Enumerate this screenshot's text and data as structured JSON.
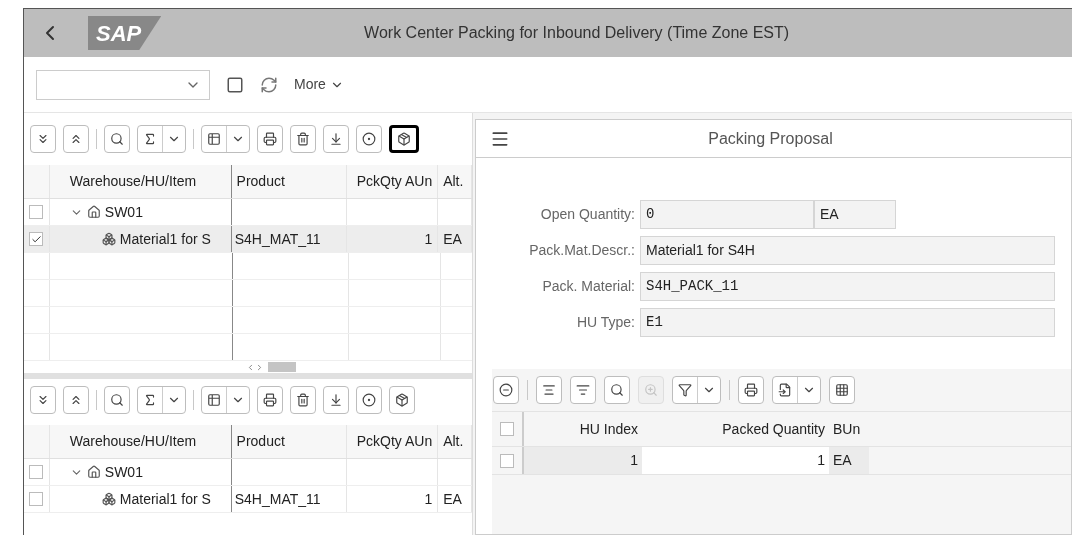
{
  "header": {
    "logo": "SAP",
    "title": "Work Center Packing for Inbound Delivery (Time Zone EST)"
  },
  "toolbar": {
    "more": "More"
  },
  "left_panel": {
    "upper_toolbar": [
      {
        "kind": "expand-all",
        "highlighted": false
      },
      {
        "kind": "collapse-all",
        "highlighted": false
      },
      {
        "kind": "sep"
      },
      {
        "kind": "search",
        "highlighted": false
      },
      {
        "kind": "sum",
        "highlighted": false
      },
      {
        "kind": "sep"
      },
      {
        "kind": "layout",
        "highlighted": false
      },
      {
        "kind": "print",
        "highlighted": false
      },
      {
        "kind": "delete",
        "highlighted": false
      },
      {
        "kind": "unpack",
        "highlighted": false
      },
      {
        "kind": "pie",
        "highlighted": false
      },
      {
        "kind": "pack",
        "highlighted": true
      }
    ],
    "upper_table": {
      "columns": [
        "Warehouse/HU/Item",
        "Product",
        "PckQty AUn",
        "Alt."
      ],
      "rows": [
        {
          "kind": "warehouse",
          "checked": false,
          "selected": false,
          "expanded": true,
          "item": "SW01"
        },
        {
          "kind": "product",
          "checked": true,
          "selected": true,
          "item": "Material1 for S",
          "product": "S4H_MAT_11",
          "qty": "1",
          "unit": "EA"
        }
      ]
    },
    "lower_toolbar": [
      {
        "kind": "expand-all",
        "highlighted": false
      },
      {
        "kind": "collapse-all",
        "highlighted": false
      },
      {
        "kind": "sep"
      },
      {
        "kind": "search",
        "highlighted": false
      },
      {
        "kind": "sum",
        "highlighted": false
      },
      {
        "kind": "sep"
      },
      {
        "kind": "layout",
        "highlighted": false
      },
      {
        "kind": "print",
        "highlighted": false
      },
      {
        "kind": "delete",
        "highlighted": false
      },
      {
        "kind": "unpack",
        "highlighted": false
      },
      {
        "kind": "pie",
        "highlighted": false
      },
      {
        "kind": "pack",
        "highlighted": false
      }
    ],
    "lower_table": {
      "columns": [
        "Warehouse/HU/Item",
        "Product",
        "PckQty AUn",
        "Alt."
      ],
      "rows": [
        {
          "kind": "warehouse",
          "checked": false,
          "selected": false,
          "expanded": true,
          "item": "SW01"
        },
        {
          "kind": "product",
          "checked": false,
          "selected": false,
          "item": "Material1 for S",
          "product": "S4H_MAT_11",
          "qty": "1",
          "unit": "EA"
        }
      ]
    }
  },
  "right_panel": {
    "title": "Packing Proposal",
    "fields": [
      {
        "label": "Open Quantity:",
        "value": "0",
        "mono": true,
        "unit": "EA"
      },
      {
        "label": "Pack.Mat.Descr.:",
        "value": "Material1 for S4H",
        "mono": false
      },
      {
        "label": "Pack. Material:",
        "value": "S4H_PACK_11",
        "mono": true
      },
      {
        "label": "HU Type:",
        "value": "E1",
        "mono": true
      }
    ],
    "toolbar": [
      {
        "kind": "remove",
        "disabled": false
      },
      {
        "kind": "sep"
      },
      {
        "kind": "align",
        "disabled": false
      },
      {
        "kind": "list-filter",
        "disabled": false
      },
      {
        "kind": "search",
        "disabled": false
      },
      {
        "kind": "zoom-in",
        "disabled": true
      },
      {
        "kind": "filter",
        "disabled": false
      },
      {
        "kind": "sep"
      },
      {
        "kind": "print",
        "disabled": false
      },
      {
        "kind": "export",
        "disabled": false
      },
      {
        "kind": "grid",
        "disabled": false
      }
    ],
    "table": {
      "header_checked": false,
      "columns": [
        "HU Index",
        "Packed Quantity",
        "BUn"
      ],
      "rows": [
        {
          "checked": false,
          "hu_index": "1",
          "packed_quantity": "1",
          "bun": "EA"
        }
      ]
    }
  }
}
